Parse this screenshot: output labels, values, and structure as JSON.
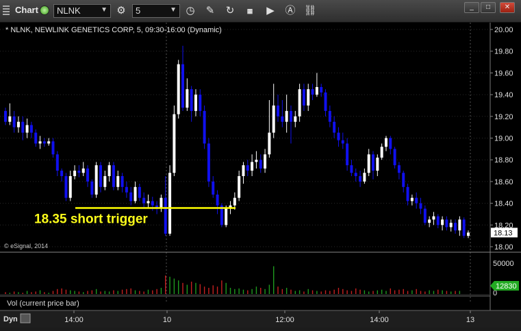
{
  "toolbar": {
    "title": "Chart",
    "symbol": "NLNK",
    "interval": "5",
    "window_buttons": [
      "_",
      "□",
      "✕"
    ]
  },
  "chart": {
    "header": "* NLNK, NEWLINK GENETICS CORP, 5, 09:30-16:00 (Dynamic)",
    "copyright": "© eSignal, 2014",
    "annotation": "18.35 short trigger",
    "last_price": "18.13",
    "volume_pane_label": "Vol (current price bar)",
    "volume_last": "12830",
    "bottom_left": "Dyn",
    "colors": {
      "up": "#ffffff",
      "down": "#1010ee",
      "trigger": "#ffff00",
      "vol_up": "#1e9a1e",
      "vol_down": "#c62020",
      "price_tag": "#ffffff",
      "vol_tag": "#22aa22"
    }
  },
  "chart_data": {
    "type": "candlestick",
    "y_ticks": [
      "20.00",
      "19.80",
      "19.60",
      "19.40",
      "19.20",
      "19.00",
      "18.80",
      "18.60",
      "18.40",
      "18.20",
      "18.00"
    ],
    "ylim": [
      17.98,
      20.05
    ],
    "x_ticks": [
      "14:00",
      "10",
      "12:00",
      "14:00",
      "13"
    ],
    "volume_ticks": [
      "50000",
      "0"
    ],
    "trigger_level": 18.35,
    "candles": [
      [
        19.25,
        19.15,
        19.28,
        19.12
      ],
      [
        19.15,
        19.2,
        19.32,
        19.12
      ],
      [
        19.2,
        19.1,
        19.25,
        19.05
      ],
      [
        19.1,
        19.15,
        19.2,
        19.05
      ],
      [
        19.15,
        19.05,
        19.2,
        18.98
      ],
      [
        19.05,
        19.12,
        19.18,
        19.0
      ],
      [
        19.12,
        19.05,
        19.15,
        19.0
      ],
      [
        19.05,
        18.95,
        19.08,
        18.92
      ],
      [
        18.95,
        18.97,
        19.02,
        18.9
      ],
      [
        18.97,
        18.95,
        19.0,
        18.92
      ],
      [
        18.95,
        18.97,
        19.0,
        18.93
      ],
      [
        18.97,
        18.85,
        19.0,
        18.82
      ],
      [
        18.85,
        18.7,
        18.88,
        18.65
      ],
      [
        18.7,
        18.65,
        18.72,
        18.6
      ],
      [
        18.65,
        18.45,
        18.68,
        18.42
      ],
      [
        18.45,
        18.65,
        18.7,
        18.42
      ],
      [
        18.65,
        18.7,
        18.75,
        18.62
      ],
      [
        18.7,
        18.68,
        18.75,
        18.64
      ],
      [
        18.68,
        18.72,
        18.78,
        18.65
      ],
      [
        18.72,
        18.6,
        18.75,
        18.55
      ],
      [
        18.6,
        18.48,
        18.62,
        18.45
      ],
      [
        18.48,
        18.75,
        18.78,
        18.45
      ],
      [
        18.75,
        18.55,
        18.78,
        18.5
      ],
      [
        18.55,
        18.65,
        18.7,
        18.52
      ],
      [
        18.65,
        18.75,
        18.78,
        18.6
      ],
      [
        18.75,
        18.55,
        18.78,
        18.52
      ],
      [
        18.55,
        18.65,
        18.7,
        18.52
      ],
      [
        18.65,
        18.55,
        18.68,
        18.5
      ],
      [
        18.55,
        18.5,
        18.6,
        18.45
      ],
      [
        18.5,
        18.42,
        18.55,
        18.38
      ],
      [
        18.42,
        18.55,
        18.6,
        18.4
      ],
      [
        18.55,
        18.45,
        18.58,
        18.42
      ],
      [
        18.45,
        18.4,
        18.5,
        18.35
      ],
      [
        18.4,
        18.42,
        18.48,
        18.36
      ],
      [
        18.42,
        18.38,
        18.46,
        18.33
      ],
      [
        18.38,
        18.35,
        18.42,
        18.3
      ],
      [
        18.35,
        18.45,
        18.48,
        18.32
      ],
      [
        18.45,
        18.12,
        18.65,
        18.1
      ],
      [
        18.12,
        18.68,
        18.75,
        18.1
      ],
      [
        18.68,
        19.22,
        19.3,
        18.65
      ],
      [
        19.22,
        19.68,
        19.72,
        19.18
      ],
      [
        19.68,
        19.28,
        19.85,
        19.25
      ],
      [
        19.28,
        19.45,
        19.55,
        19.25
      ],
      [
        19.45,
        19.25,
        19.48,
        19.15
      ],
      [
        19.25,
        19.4,
        19.45,
        19.2
      ],
      [
        19.4,
        19.25,
        19.45,
        19.2
      ],
      [
        19.25,
        18.95,
        19.3,
        18.9
      ],
      [
        18.95,
        18.6,
        19.0,
        18.55
      ],
      [
        18.6,
        18.48,
        18.65,
        18.45
      ],
      [
        18.48,
        18.38,
        18.52,
        18.3
      ],
      [
        18.38,
        18.2,
        18.4,
        18.18
      ],
      [
        18.2,
        18.35,
        18.38,
        18.18
      ],
      [
        18.35,
        18.38,
        18.42,
        18.3
      ],
      [
        18.38,
        18.45,
        18.5,
        18.34
      ],
      [
        18.45,
        18.65,
        18.7,
        18.42
      ],
      [
        18.65,
        18.75,
        18.78,
        18.58
      ],
      [
        18.75,
        18.7,
        18.8,
        18.65
      ],
      [
        18.7,
        18.78,
        18.85,
        18.65
      ],
      [
        18.78,
        18.8,
        18.88,
        18.72
      ],
      [
        18.8,
        18.72,
        18.85,
        18.68
      ],
      [
        18.72,
        18.85,
        18.9,
        18.68
      ],
      [
        18.85,
        19.05,
        19.35,
        18.82
      ],
      [
        19.05,
        19.3,
        19.5,
        19.0
      ],
      [
        19.3,
        19.2,
        19.4,
        19.15
      ],
      [
        19.2,
        19.15,
        19.35,
        19.1
      ],
      [
        19.15,
        19.25,
        19.4,
        19.05
      ],
      [
        19.25,
        19.15,
        19.3,
        18.95
      ],
      [
        19.15,
        19.2,
        19.25,
        19.1
      ],
      [
        19.2,
        19.45,
        19.5,
        19.15
      ],
      [
        19.45,
        19.3,
        19.5,
        19.25
      ],
      [
        19.3,
        19.45,
        19.5,
        19.25
      ],
      [
        19.45,
        19.4,
        19.5,
        19.35
      ],
      [
        19.4,
        19.47,
        19.6,
        19.38
      ],
      [
        19.47,
        19.42,
        19.5,
        19.38
      ],
      [
        19.42,
        19.25,
        19.45,
        19.2
      ],
      [
        19.25,
        19.15,
        19.3,
        19.1
      ],
      [
        19.15,
        19.05,
        19.2,
        19.0
      ],
      [
        19.05,
        18.98,
        19.1,
        18.92
      ],
      [
        18.98,
        18.95,
        19.05,
        18.9
      ],
      [
        18.95,
        18.75,
        19.0,
        18.7
      ],
      [
        18.75,
        18.68,
        18.8,
        18.65
      ],
      [
        18.68,
        18.65,
        18.72,
        18.6
      ],
      [
        18.65,
        18.6,
        18.7,
        18.55
      ],
      [
        18.6,
        18.68,
        18.72,
        18.58
      ],
      [
        18.68,
        18.85,
        18.9,
        18.65
      ],
      [
        18.85,
        18.7,
        18.88,
        18.62
      ],
      [
        18.7,
        18.82,
        18.85,
        18.65
      ],
      [
        18.82,
        18.92,
        18.95,
        18.8
      ],
      [
        18.92,
        19.0,
        19.02,
        18.88
      ],
      [
        19.0,
        18.9,
        19.02,
        18.85
      ],
      [
        18.9,
        18.75,
        18.92,
        18.72
      ],
      [
        18.75,
        18.68,
        18.78,
        18.62
      ],
      [
        18.68,
        18.55,
        18.7,
        18.5
      ],
      [
        18.55,
        18.42,
        18.58,
        18.38
      ],
      [
        18.42,
        18.45,
        18.48,
        18.38
      ],
      [
        18.45,
        18.4,
        18.5,
        18.35
      ],
      [
        18.4,
        18.35,
        18.45,
        18.3
      ],
      [
        18.35,
        18.22,
        18.38,
        18.2
      ],
      [
        18.22,
        18.25,
        18.28,
        18.18
      ],
      [
        18.25,
        18.28,
        18.32,
        18.2
      ],
      [
        18.28,
        18.2,
        18.3,
        18.17
      ],
      [
        18.2,
        18.25,
        18.28,
        18.15
      ],
      [
        18.25,
        18.18,
        18.28,
        18.15
      ],
      [
        18.18,
        18.22,
        18.25,
        18.14
      ],
      [
        18.22,
        18.15,
        18.25,
        18.12
      ],
      [
        18.15,
        18.25,
        18.28,
        18.1
      ],
      [
        18.25,
        18.1,
        18.27,
        18.08
      ],
      [
        18.1,
        18.13,
        18.15,
        18.08
      ]
    ],
    "volume": [
      3,
      2,
      4,
      3,
      2,
      5,
      3,
      4,
      6,
      3,
      2,
      5,
      8,
      9,
      7,
      6,
      5,
      4,
      3,
      5,
      6,
      8,
      4,
      5,
      4,
      6,
      5,
      7,
      8,
      9,
      6,
      5,
      4,
      7,
      6,
      8,
      10,
      30,
      28,
      25,
      22,
      18,
      15,
      20,
      18,
      16,
      12,
      10,
      14,
      12,
      22,
      18,
      10,
      8,
      9,
      7,
      6,
      8,
      12,
      10,
      8,
      15,
      45,
      12,
      8,
      10,
      7,
      5,
      6,
      4,
      8,
      6,
      5,
      4,
      6,
      5,
      7,
      10,
      8,
      6,
      5,
      9,
      7,
      6,
      4,
      5,
      6,
      7,
      5,
      9,
      6,
      7,
      8,
      5,
      6,
      8,
      5,
      4,
      6,
      5,
      7,
      6,
      5,
      4,
      5,
      5
    ]
  }
}
